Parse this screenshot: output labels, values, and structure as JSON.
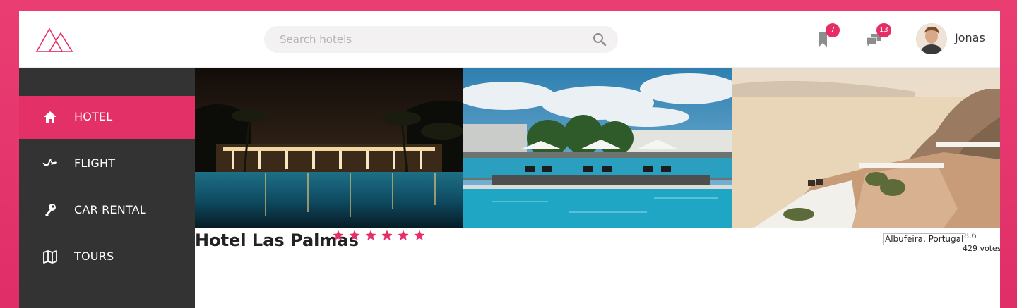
{
  "header": {
    "search_placeholder": "Search hotels",
    "bookmarks_count": "7",
    "messages_count": "13",
    "user_name": "Jonas"
  },
  "sidebar": {
    "items": [
      {
        "label": "HOTEL",
        "icon": "home-icon",
        "active": true
      },
      {
        "label": "FLIGHT",
        "icon": "airplane-icon",
        "active": false
      },
      {
        "label": "CAR RENTAL",
        "icon": "key-icon",
        "active": false
      },
      {
        "label": "TOURS",
        "icon": "map-icon",
        "active": false
      }
    ]
  },
  "hotel": {
    "name": "Hotel Las Palmas",
    "stars": 6,
    "location": "Albufeira, Portugal",
    "rating": "8.6",
    "votes": "429 votes"
  },
  "gallery": {
    "photos": [
      "night-pool-photo",
      "day-pool-photo",
      "seaside-terrace-photo"
    ]
  },
  "colors": {
    "accent": "#e33067",
    "sidebar": "#333333",
    "badge": "#e62e66"
  }
}
